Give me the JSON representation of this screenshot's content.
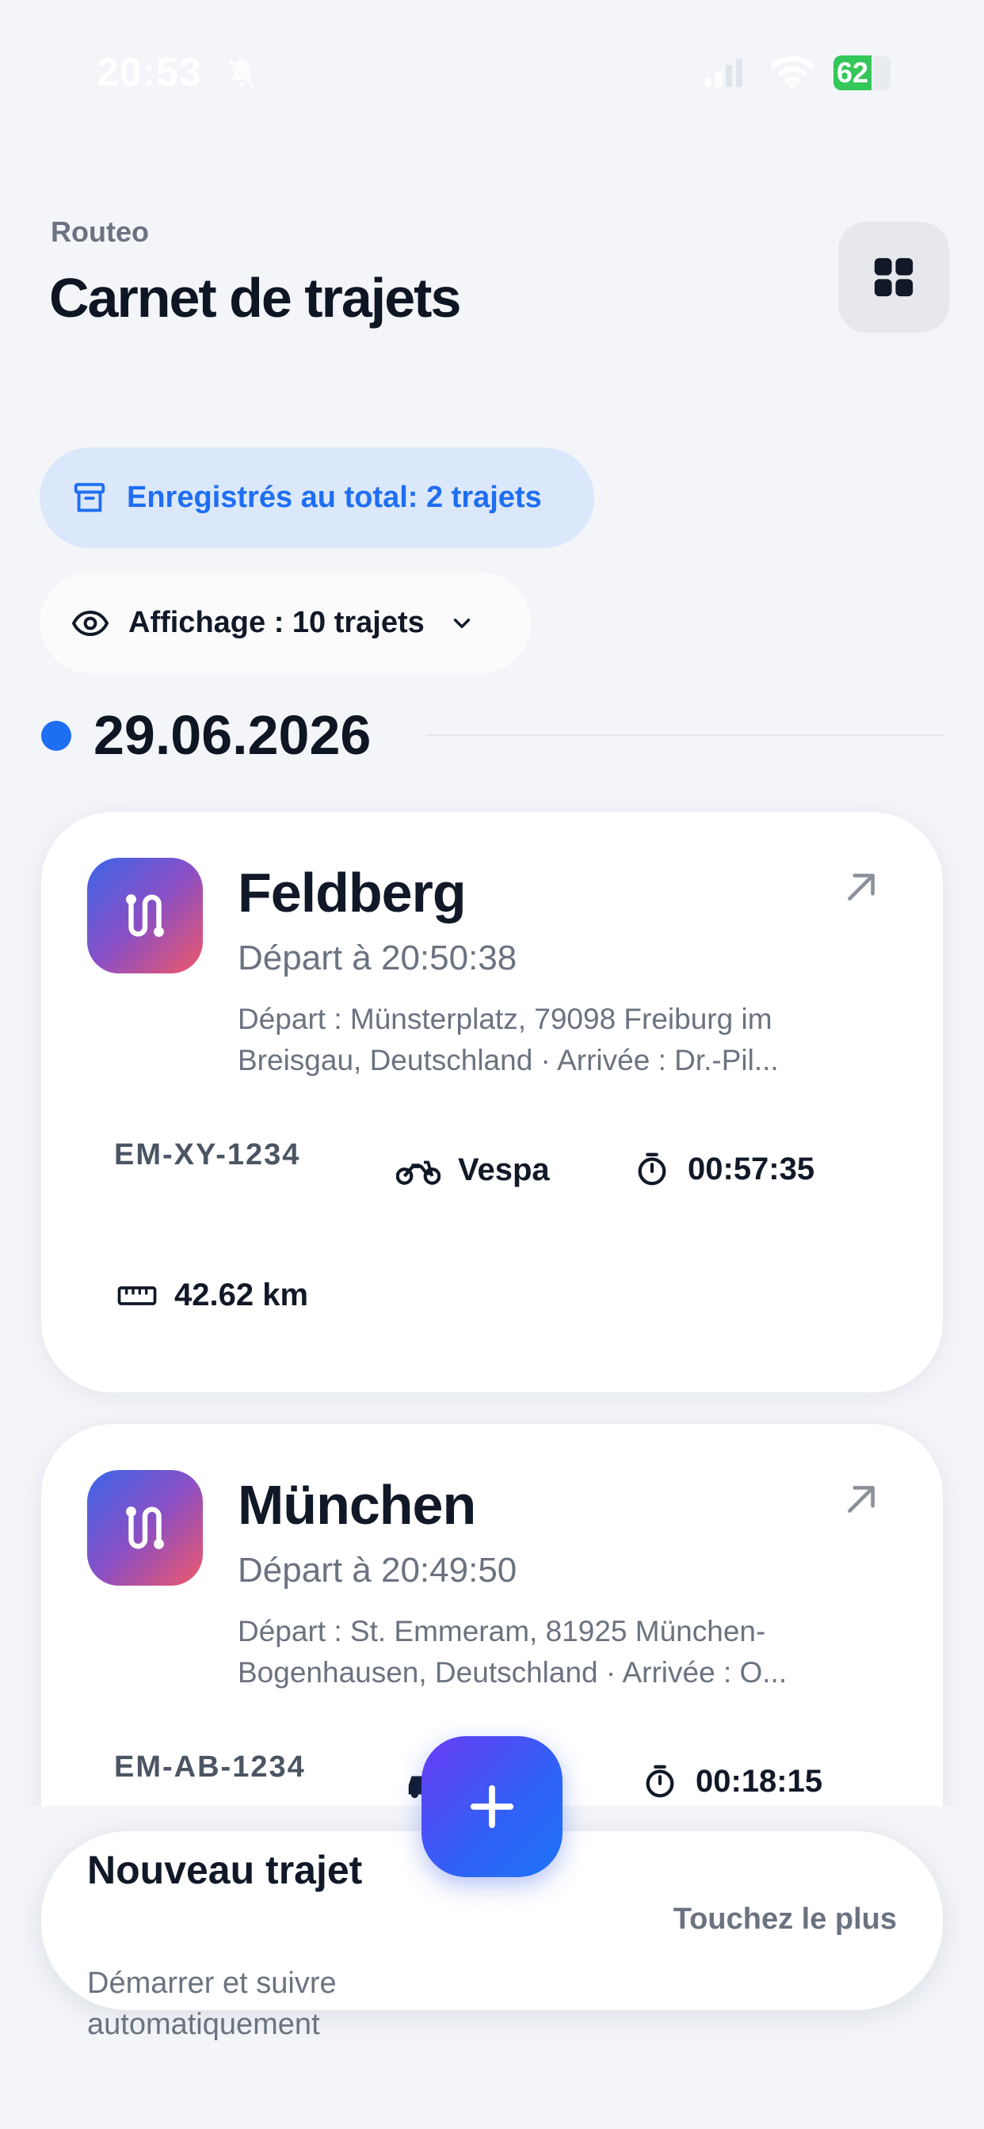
{
  "status_bar": {
    "time": "20:53",
    "battery": "62",
    "icons": [
      "bell-slash-icon",
      "signal-icon",
      "wifi-icon",
      "battery-icon"
    ]
  },
  "header": {
    "app_name": "Routeo",
    "title": "Carnet de trajets",
    "grid_icon": "grid-icon"
  },
  "filters": {
    "total_label": "Enregistrés au total: 2 trajets",
    "display_label": "Affichage : 10 trajets"
  },
  "date_group": {
    "date": "29.06.2026"
  },
  "trips": [
    {
      "name": "Feldberg",
      "departure_time": "Départ à 20:50:38",
      "address": "Départ : Münsterplatz, 79098 Freiburg im Breisgau, Deutschland · Arrivée : Dr.-Pil...",
      "plate": "EM-XY-1234",
      "vehicle": "Vespa",
      "duration": "00:57:35",
      "distance": "42.62 km"
    },
    {
      "name": "München",
      "departure_time": "Départ à 20:49:50",
      "address": "Départ : St. Emmeram, 81925 München-Bogenhausen, Deutschland · Arrivée : O...",
      "plate": "EM-AB-1234",
      "duration": "00:18:15"
    }
  ],
  "new_trip": {
    "title": "Nouveau trajet",
    "subtitle": "Démarrer et suivre automatiquement",
    "hint": "Touchez le plus"
  },
  "colors": {
    "accent": "#1e6ef2",
    "background": "#f3f5f9",
    "card": "#ffffff"
  }
}
